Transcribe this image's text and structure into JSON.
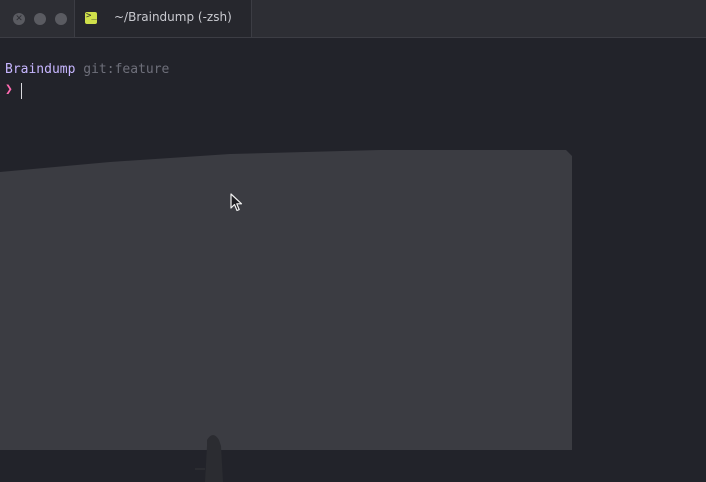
{
  "window": {
    "tab_title": "~/Braindump (-zsh)",
    "tab_icon": "terminal-icon"
  },
  "prompt": {
    "directory": "Braindump",
    "git_info": "git:feature",
    "chevron": "❯"
  },
  "colors": {
    "directory": "#c7b6ff",
    "git": "#6e6f7a",
    "chevron": "#ff6bb1",
    "tab_icon": "#cfe04a"
  }
}
